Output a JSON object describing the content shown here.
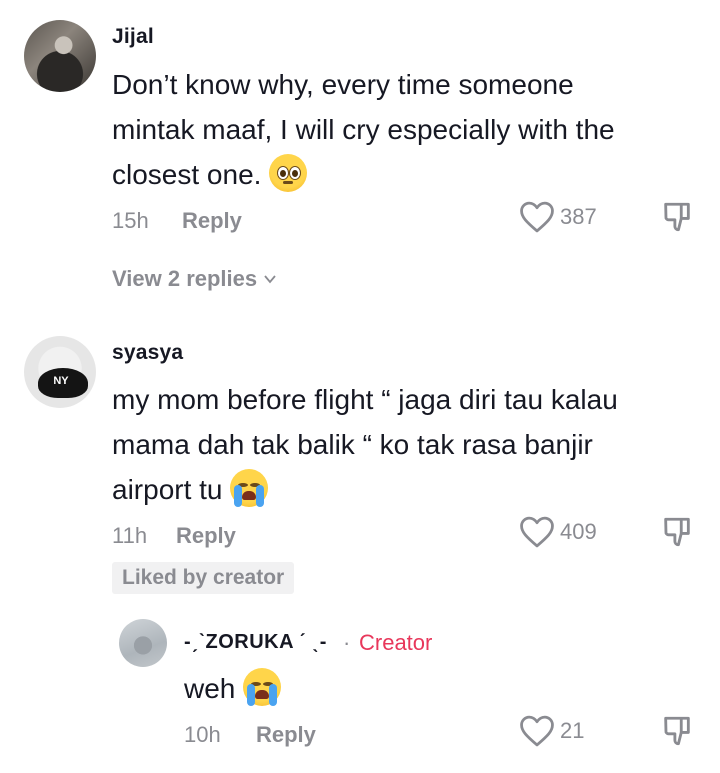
{
  "comments": [
    {
      "username": "Jijal",
      "lines": [
        "Don’t know why, every time someone",
        "mintak maaf, I will cry especially with the",
        "closest one."
      ],
      "time": "15h",
      "reply_label": "Reply",
      "likes": "387",
      "view_replies": "View 2 replies",
      "emoji": "pleading-face"
    },
    {
      "username": "syasya",
      "lines": [
        "my mom before flight “ jaga diri tau kalau",
        "mama dah tak balik “ ko tak rasa banjir",
        "airport tu"
      ],
      "time": "11h",
      "reply_label": "Reply",
      "likes": "409",
      "badge": "Liked by creator",
      "emoji": "loudly-crying-face"
    }
  ],
  "reply": {
    "username": "-ˏˋZORUKA ˊ ˎ-",
    "separator": "·",
    "creator_label": "Creator",
    "text": "weh",
    "time": "10h",
    "reply_label": "Reply",
    "likes": "21",
    "emoji": "loudly-crying-face"
  },
  "colors": {
    "accent": "#e8375b",
    "muted": "#8a8b91",
    "text": "#161823",
    "badge_bg": "#f1f1f2"
  }
}
